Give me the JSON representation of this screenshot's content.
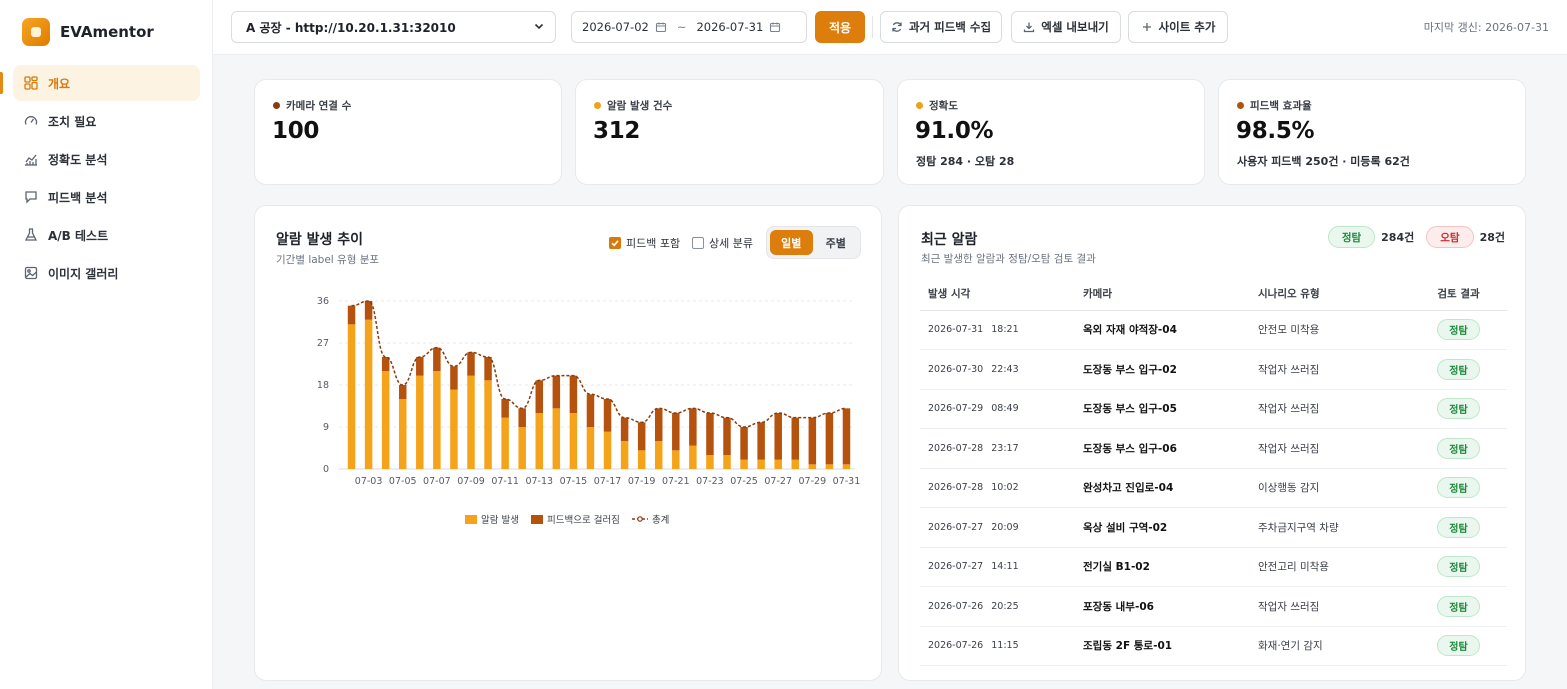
{
  "app": {
    "name": "EVAmentor"
  },
  "sidebar": {
    "items": [
      {
        "label": "개요",
        "icon": "dashboard-icon",
        "active": true
      },
      {
        "label": "조치 필요",
        "icon": "gauge-icon",
        "active": false
      },
      {
        "label": "정확도 분석",
        "icon": "line-chart-icon",
        "active": false
      },
      {
        "label": "피드백 분석",
        "icon": "message-icon",
        "active": false
      },
      {
        "label": "A/B 테스트",
        "icon": "flask-icon",
        "active": false
      },
      {
        "label": "이미지 갤러리",
        "icon": "image-icon",
        "active": false
      }
    ]
  },
  "topbar": {
    "site_selected": "A 공장 - http://10.20.1.31:32010",
    "date_from": "2026-07-02",
    "date_to": "2026-07-31",
    "date_sep": "~",
    "apply_label": "적용",
    "collect_label": "과거 피드백 수집",
    "export_label": "엑셀 내보내기",
    "add_site_label": "사이트 추가",
    "last_update": "마지막 갱신: 2026-07-31"
  },
  "stats": [
    {
      "label": "카메라 연결 수",
      "value": "100",
      "sub": "",
      "color": "#8b3a0e"
    },
    {
      "label": "알람 발생 건수",
      "value": "312",
      "sub": "",
      "color": "#f0a11a"
    },
    {
      "label": "정확도",
      "value": "91.0%",
      "sub": "정탐 284 · 오탐 28",
      "color": "#f0a11a"
    },
    {
      "label": "피드백 효과율",
      "value": "98.5%",
      "sub": "사용자 피드백 250건 · 미등록 62건",
      "color": "#b3520d"
    }
  ],
  "trend": {
    "title": "알람 발생 추이",
    "subtitle": "기간별 label 유형 분포",
    "include_feedback_label": "피드백 포함",
    "include_feedback": true,
    "detail_label": "상세 분류",
    "detail": false,
    "daily_label": "일별",
    "weekly_label": "주별"
  },
  "chart_data": {
    "type": "bar",
    "stacked": true,
    "categories": [
      "07-02",
      "07-03",
      "07-04",
      "07-05",
      "07-06",
      "07-07",
      "07-08",
      "07-09",
      "07-10",
      "07-11",
      "07-12",
      "07-13",
      "07-14",
      "07-15",
      "07-16",
      "07-17",
      "07-18",
      "07-19",
      "07-20",
      "07-21",
      "07-22",
      "07-23",
      "07-24",
      "07-25",
      "07-26",
      "07-27",
      "07-28",
      "07-29",
      "07-30",
      "07-31"
    ],
    "tick_labels": [
      "07-03",
      "07-05",
      "07-07",
      "07-09",
      "07-11",
      "07-13",
      "07-15",
      "07-17",
      "07-19",
      "07-21",
      "07-23",
      "07-25",
      "07-27",
      "07-29",
      "07-31"
    ],
    "series": [
      {
        "name": "알람 발생",
        "color": "#f5a31a",
        "values": [
          31,
          32,
          21,
          15,
          20,
          21,
          17,
          20,
          19,
          11,
          9,
          12,
          13,
          12,
          9,
          8,
          6,
          4,
          6,
          4,
          5,
          3,
          3,
          2,
          2,
          2,
          2,
          1,
          1,
          1
        ]
      },
      {
        "name": "피드백으로 걸러짐",
        "color": "#b5530e",
        "values": [
          4,
          4,
          3,
          3,
          4,
          5,
          5,
          5,
          5,
          4,
          4,
          7,
          7,
          8,
          7,
          7,
          5,
          6,
          7,
          8,
          8,
          9,
          8,
          7,
          8,
          10,
          9,
          10,
          11,
          12
        ]
      },
      {
        "name": "총계",
        "color": "#8b3a0e",
        "type": "line",
        "style": "dashed",
        "values": [
          35,
          36,
          24,
          18,
          24,
          26,
          22,
          25,
          24,
          15,
          13,
          19,
          20,
          20,
          16,
          15,
          11,
          10,
          13,
          12,
          13,
          12,
          11,
          9,
          10,
          12,
          11,
          11,
          12,
          13
        ]
      }
    ],
    "yticks": [
      0,
      9,
      18,
      27,
      36
    ],
    "ylim": [
      0,
      38
    ],
    "grid": true,
    "legend": "bottom-center"
  },
  "recent": {
    "title": "최근 알람",
    "subtitle": "최근 발생한 알람과 정탐/오탐 검토 결과",
    "ok_label": "정탐",
    "ok_count": "284건",
    "ng_label": "오탐",
    "ng_count": "28건",
    "columns": [
      "발생 시각",
      "카메라",
      "시나리오 유형",
      "검토 결과"
    ],
    "rows": [
      {
        "time": "2026-07-31 18:21",
        "camera": "옥외 자재 야적장-04",
        "scenario": "안전모 미착용",
        "result": "정탐"
      },
      {
        "time": "2026-07-30 22:43",
        "camera": "도장동 부스 입구-02",
        "scenario": "작업자 쓰러짐",
        "result": "정탐"
      },
      {
        "time": "2026-07-29 08:49",
        "camera": "도장동 부스 입구-05",
        "scenario": "작업자 쓰러짐",
        "result": "정탐"
      },
      {
        "time": "2026-07-28 23:17",
        "camera": "도장동 부스 입구-06",
        "scenario": "작업자 쓰러짐",
        "result": "정탐"
      },
      {
        "time": "2026-07-28 10:02",
        "camera": "완성차고 진입로-04",
        "scenario": "이상행동 감지",
        "result": "정탐"
      },
      {
        "time": "2026-07-27 20:09",
        "camera": "옥상 설비 구역-02",
        "scenario": "주차금지구역 차량",
        "result": "정탐"
      },
      {
        "time": "2026-07-27 14:11",
        "camera": "전기실 B1-02",
        "scenario": "안전고리 미착용",
        "result": "정탐"
      },
      {
        "time": "2026-07-26 20:25",
        "camera": "포장동 내부-06",
        "scenario": "작업자 쓰러짐",
        "result": "정탐"
      },
      {
        "time": "2026-07-26 11:15",
        "camera": "조립동 2F 통로-01",
        "scenario": "화재·연기 감지",
        "result": "정탐"
      }
    ]
  }
}
